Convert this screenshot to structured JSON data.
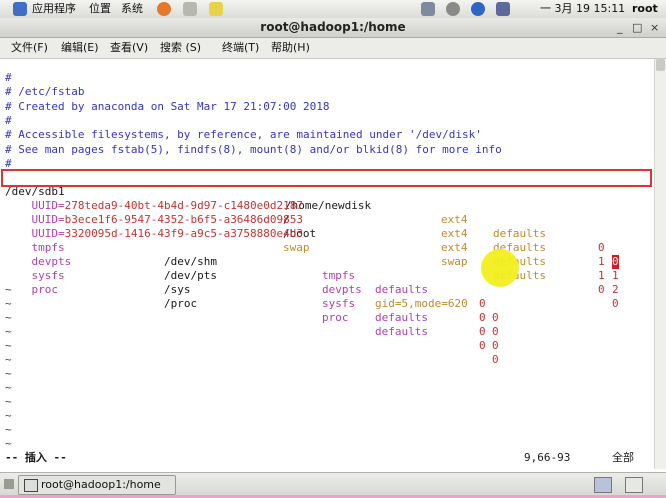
{
  "panel": {
    "apps": "应用程序",
    "places": "位置",
    "system": "系统",
    "clock": "一 3月 19 15:11",
    "user": "root"
  },
  "window": {
    "title": "root@hadoop1:/home",
    "minimize": "_",
    "maximize": "□",
    "close": "×"
  },
  "menu": [
    "文件(F)",
    "编辑(E)",
    "查看(V)",
    "搜索 (S)",
    "终端(T)",
    "帮助(H)"
  ],
  "terminal": {
    "comments": [
      "#",
      "# /etc/fstab",
      "# Created by anaconda on Sat Mar 17 21:07:00 2018",
      "#",
      "# Accessible filesystems, by reference, are maintained under '/dev/disk'",
      "# See man pages fstab(5), findfs(8), mount(8) and/or blkid(8) for more info",
      "#"
    ],
    "line_new": {
      "device": "/dev/sdb1",
      "mount": "/home/newdisk",
      "type": "ext4",
      "options": "defaults",
      "dump": "0",
      "pass": "0"
    },
    "uuid_rows": [
      {
        "key": "UUID=",
        "val": "278teda9-40bt-4b4d-9d97-c1480e0d2187",
        "mount": "/",
        "type": "ext4",
        "options": "defaults",
        "dump": "1",
        "pass": "1"
      },
      {
        "key": "UUID=",
        "val": "b3ece1f6-9547-4352-b6f5-a36486d09853",
        "mount": "/boot",
        "type": "ext4",
        "options": "defaults",
        "dump": "1",
        "pass": "2"
      },
      {
        "key": "UUID=",
        "val": "3320095d-1416-43f9-a9c5-a3758880e4d3",
        "mount": "swap",
        "type": "swap",
        "options": "defaults",
        "dump": "0",
        "pass": "0"
      }
    ],
    "mem_rows": [
      {
        "device": "tmpfs",
        "mount": "/dev/shm",
        "type": "tmpfs",
        "options": "defaults",
        "dump": "0",
        "pass": "0"
      },
      {
        "device": "devpts",
        "mount": "/dev/pts",
        "type": "devpts",
        "options": "gid=5,mode=620",
        "dump": "0",
        "pass": "0"
      },
      {
        "device": "sysfs",
        "mount": "/sys",
        "type": "sysfs",
        "options": "defaults",
        "dump": "0",
        "pass": "0"
      },
      {
        "device": "proc",
        "mount": "/proc",
        "type": "proc",
        "options": "defaults",
        "dump": "0",
        "pass": "0"
      }
    ],
    "tilde": "~",
    "status_mode": "-- 插入 --",
    "status_pos": "9,66-93",
    "status_all": "全部"
  },
  "taskbar": {
    "task_label": "root@hadoop1:/home"
  },
  "colors": {
    "highlight": "#e03434",
    "comment": "#3535c8",
    "cursor": "#d21e1e"
  }
}
